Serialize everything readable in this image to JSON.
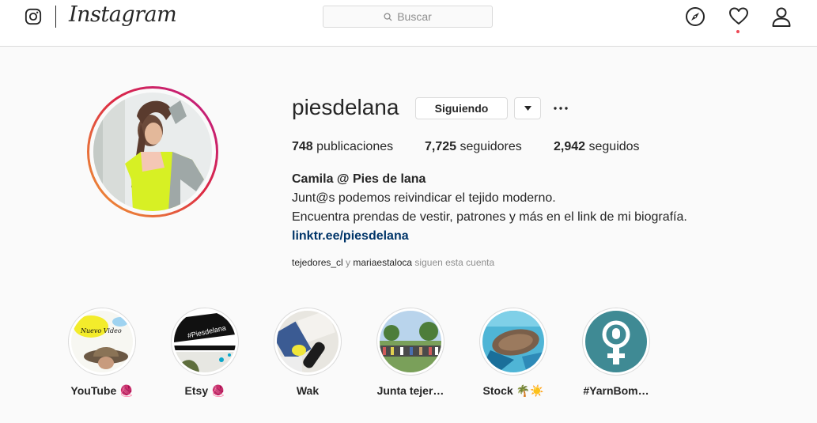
{
  "header": {
    "wordmark": "Instagram",
    "search_placeholder": "Buscar",
    "icons": [
      "instagram-glyph-icon",
      "compass-icon",
      "heart-icon",
      "user-icon"
    ],
    "activity_dot_color": "#ed4956"
  },
  "profile": {
    "username": "piesdelana",
    "follow_button": "Siguiendo",
    "stats": [
      {
        "count": "748",
        "label": "publicaciones"
      },
      {
        "count": "7,725",
        "label": "seguidores"
      },
      {
        "count": "2,942",
        "label": "seguidos"
      }
    ],
    "full_name": "Camila @ Pies de lana",
    "bio": [
      "Junt@s podemos reivindicar el tejido moderno.",
      "Encuentra prendas de vestir, patrones y más en el link de mi biografía."
    ],
    "link": "linktr.ee/piesdelana",
    "followed_by": {
      "account_1": "tejedores_cl",
      "connector": " y ",
      "account_2": "mariaestaloca",
      "suffix": " siguen esta cuenta"
    }
  },
  "highlights": [
    {
      "label": "YouTube 🧶",
      "thumb_text": "Nuevo Video"
    },
    {
      "label": "Etsy 🧶",
      "thumb_text": "#Piesdelana"
    },
    {
      "label": "Wak"
    },
    {
      "label": "Junta tejer…"
    },
    {
      "label": "Stock 🌴☀️"
    },
    {
      "label": "#YarnBom…"
    }
  ],
  "colors": {
    "link": "#003569",
    "muted": "#8e8e8e",
    "border": "#dbdbdb",
    "text": "#262626",
    "feminist_teal": "#3f8a94"
  }
}
